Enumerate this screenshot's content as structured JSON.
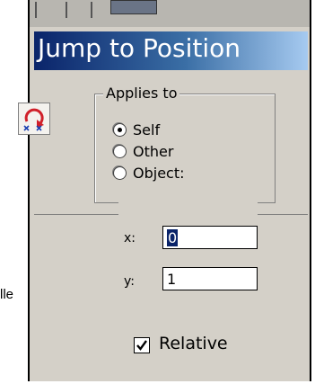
{
  "window": {
    "title": "Jump to Position"
  },
  "applies_to": {
    "legend": "Applies to",
    "options": [
      {
        "label": "Self",
        "selected": true
      },
      {
        "label": "Other",
        "selected": false
      },
      {
        "label": "Object:",
        "selected": false
      }
    ]
  },
  "fields": {
    "x": {
      "label": "x:",
      "value": "0"
    },
    "y": {
      "label": "y:",
      "value": "1"
    }
  },
  "relative": {
    "label": "Relative",
    "checked": true
  },
  "side_text": "lle",
  "icons": {
    "action": "jump-to-position-icon"
  },
  "colors": {
    "titlebar_start": "#0a246a",
    "titlebar_end": "#a6caf0",
    "dialog_bg": "#d4d0c8"
  }
}
